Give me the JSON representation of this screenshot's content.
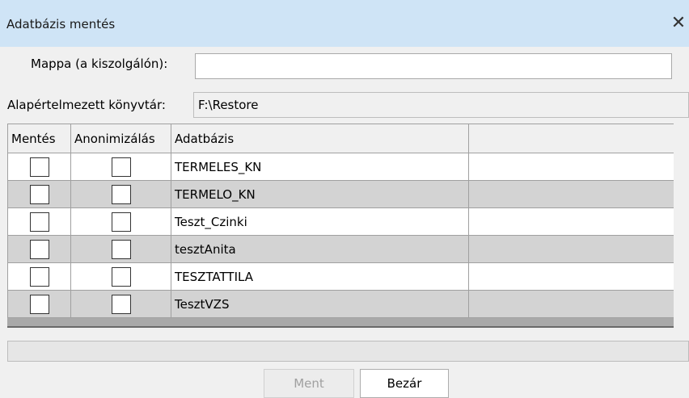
{
  "window": {
    "title": "Adatbázis mentés",
    "close_glyph": "✕"
  },
  "form": {
    "folder_label": "Mappa (a kiszolgálón):",
    "folder_value": "",
    "default_dir_label": "Alapértelmezett könyvtár:",
    "default_dir_value": "F:\\Restore"
  },
  "grid": {
    "headers": [
      "Mentés",
      "Anonimizálás",
      "Adatbázis",
      ""
    ],
    "rows": [
      {
        "backup": false,
        "anonymize": false,
        "database": "TERMELES_KN",
        "extra": ""
      },
      {
        "backup": false,
        "anonymize": false,
        "database": "TERMELO_KN",
        "extra": ""
      },
      {
        "backup": false,
        "anonymize": false,
        "database": "Teszt_Czinki",
        "extra": ""
      },
      {
        "backup": false,
        "anonymize": false,
        "database": "tesztAnita",
        "extra": ""
      },
      {
        "backup": false,
        "anonymize": false,
        "database": "TESZTATTILA",
        "extra": ""
      },
      {
        "backup": false,
        "anonymize": false,
        "database": "TesztVZS",
        "extra": ""
      }
    ]
  },
  "progress": {
    "value": 0
  },
  "buttons": {
    "save_label": "Ment",
    "save_enabled": false,
    "close_label": "Bezár"
  },
  "colors": {
    "titlebar": "#cfe4f6",
    "row_alt": "#d3d3d3"
  }
}
